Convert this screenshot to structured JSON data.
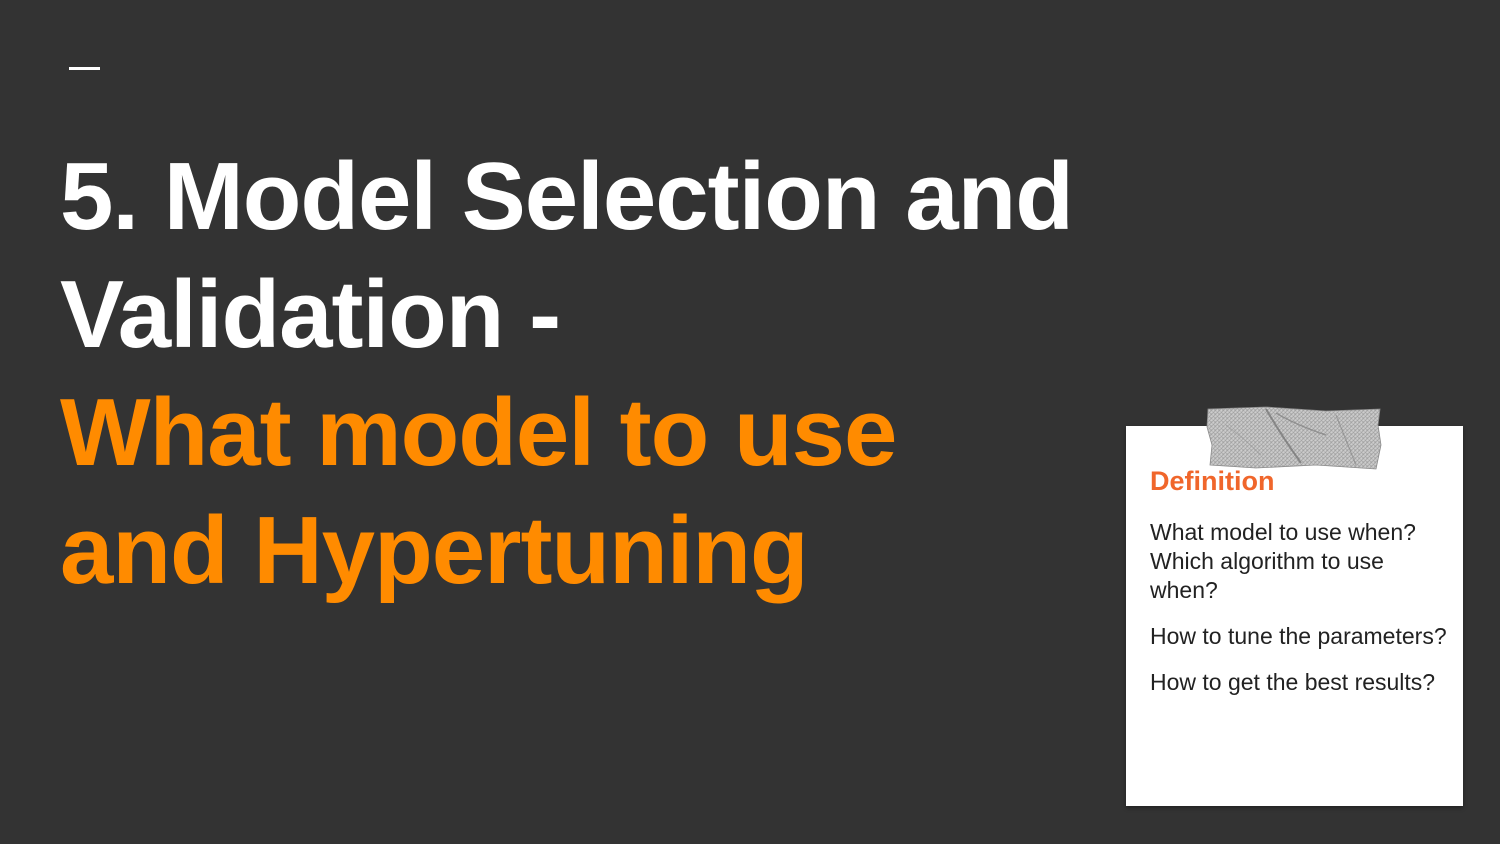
{
  "slide": {
    "title_white_line1": "5. Model Selection and",
    "title_white_line2": "Validation -",
    "title_orange_line1": "What model to use",
    "title_orange_line2": "and Hypertuning"
  },
  "note": {
    "heading": "Definition",
    "paragraphs": [
      "What model to use when? Which algorithm to use when?",
      "How to tune the parameters?",
      "How to get the best results?"
    ]
  },
  "colors": {
    "background": "#333333",
    "title_white": "#ffffff",
    "title_accent": "#ff8b00",
    "note_heading": "#f0662b"
  }
}
